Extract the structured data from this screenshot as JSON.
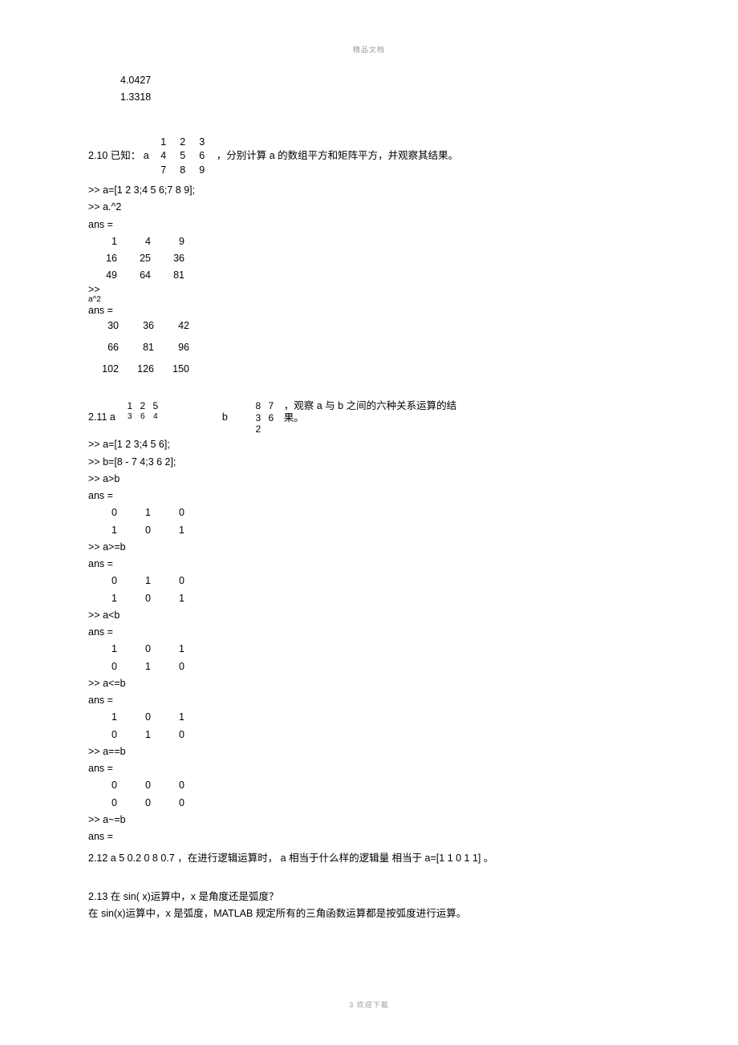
{
  "header": "精品文档",
  "intro_values": [
    "4.0427",
    "1.3318"
  ],
  "q210": {
    "label": "2.10 已知：  a",
    "matrix": [
      [
        "1",
        "2",
        "3"
      ],
      [
        "4",
        "5",
        "6"
      ],
      [
        "7",
        "8",
        "9"
      ]
    ],
    "tail": "，分别计算    a 的数组平方和矩阵平方，并观察其结果。"
  },
  "code210": [
    ">> a=[1 2 3;4 5 6;7 8 9];",
    ">> a.^2",
    "ans ="
  ],
  "mat210a": [
    [
      "1",
      "4",
      "9"
    ],
    [
      "16",
      "25",
      "36"
    ],
    [
      "49",
      "64",
      "81"
    ]
  ],
  "code210b": [
    ">>",
    "a^2",
    "ans ="
  ],
  "mat210b": [
    [
      "30",
      "36",
      "42"
    ],
    [
      "66",
      "81",
      "96"
    ],
    [
      "102",
      "126",
      "150"
    ]
  ],
  "q211": {
    "label": "2.11   a",
    "m1": [
      [
        "1",
        "2",
        "5"
      ],
      [
        "3",
        "6",
        "4"
      ]
    ],
    "mid": "b",
    "m2": [
      [
        "8",
        "7"
      ],
      [
        "3",
        "6"
      ],
      [
        "2",
        ""
      ]
    ],
    "tail1": "，观察 a 与 b 之间的六种关系运算的结",
    "tail2": "果。"
  },
  "code211": [
    ">> a=[1 2 3;4 5 6];",
    ">> b=[8       - 7 4;3 6 2];",
    ">> a>b",
    "ans ="
  ],
  "rel_gt": [
    [
      "0",
      "1",
      "0"
    ],
    [
      "1",
      "0",
      "1"
    ]
  ],
  "code_ge": [
    ">> a>=b",
    "ans ="
  ],
  "rel_ge": [
    [
      "0",
      "1",
      "0"
    ],
    [
      "1",
      "0",
      "1"
    ]
  ],
  "code_lt": [
    ">> a<b",
    "ans ="
  ],
  "rel_lt": [
    [
      "1",
      "0",
      "1"
    ],
    [
      "0",
      "1",
      "0"
    ]
  ],
  "code_le": [
    ">> a<=b",
    "ans ="
  ],
  "rel_le": [
    [
      "1",
      "0",
      "1"
    ],
    [
      "0",
      "1",
      "0"
    ]
  ],
  "code_eq": [
    ">> a==b",
    "ans ="
  ],
  "rel_eq": [
    [
      "0",
      "0",
      "0"
    ],
    [
      "0",
      "0",
      "0"
    ]
  ],
  "code_ne": [
    ">> a~=b",
    "ans ="
  ],
  "q212": "2.12 a 5 0.2 0 8 0.7 ，在进行逻辑运算时， a 相当于什么样的逻辑量  相当于 a=[1 1 0 1 1] 。",
  "q213a": "2.13 在 sin( x)运算中，x 是角度还是弧度？",
  "q213b": "在 sin(x)运算中，x 是弧度，MATLAB 规定所有的三角函数运算都是按弧度进行运算。",
  "footer": "3 欢迎下载"
}
